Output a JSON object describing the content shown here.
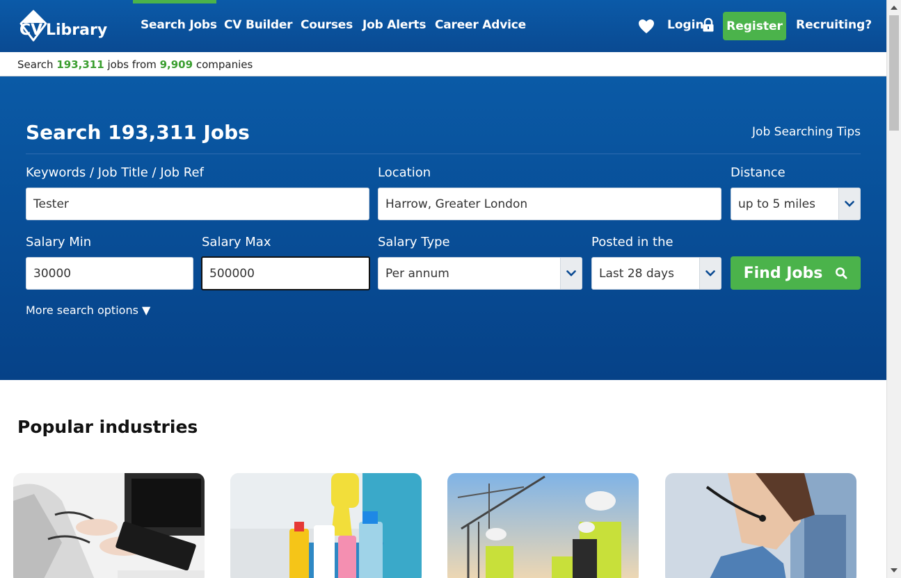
{
  "header": {
    "logo_text": "CV Library",
    "nav": [
      "Search Jobs",
      "CV Builder",
      "Courses",
      "Job Alerts",
      "Career Advice"
    ],
    "login": "Login",
    "register": "Register",
    "recruiting": "Recruiting?"
  },
  "subbar": {
    "prefix": "Search",
    "jobs_count": "193,311",
    "jobs_word": "jobs",
    "from_word": "from",
    "companies_count": "9,909",
    "companies_word": "companies"
  },
  "search": {
    "title": "Search 193,311 Jobs",
    "tips_link": "Job Searching Tips",
    "keywords_label": "Keywords / Job Title / Job Ref",
    "keywords_value": "Tester",
    "location_label": "Location",
    "location_value": "Harrow, Greater London",
    "distance_label": "Distance",
    "distance_value": "up to 5 miles",
    "salary_min_label": "Salary Min",
    "salary_min_value": "30000",
    "salary_max_label": "Salary Max",
    "salary_max_value": "500000",
    "salary_type_label": "Salary Type",
    "salary_type_value": "Per annum",
    "posted_label": "Posted in the",
    "posted_value": "Last 28 days",
    "find_button": "Find Jobs",
    "more_options": "More search options ▼"
  },
  "industries": {
    "title": "Popular industries"
  },
  "colors": {
    "brand_blue": "#0a4a92",
    "accent_green": "#4bb34b",
    "count_green": "#3a9e2f"
  }
}
